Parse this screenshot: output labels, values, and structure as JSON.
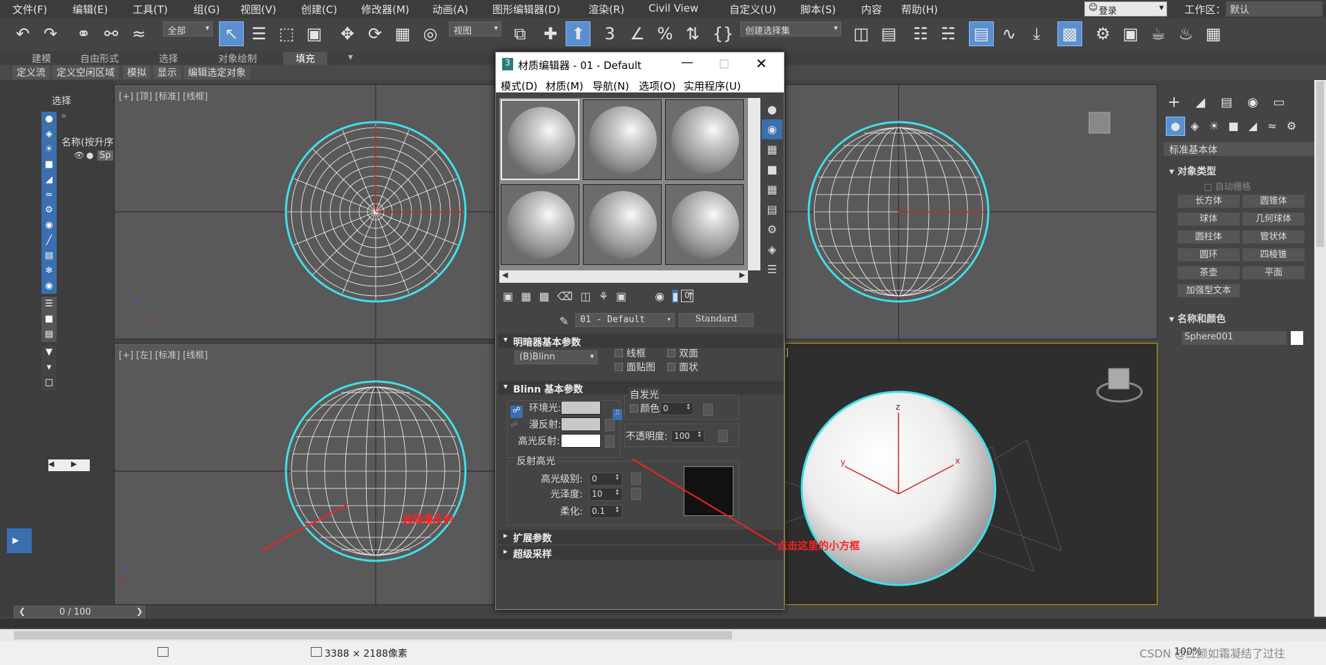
{
  "menu": [
    "文件(F)",
    "编辑(E)",
    "工具(T)",
    "组(G)",
    "视图(V)",
    "创建(C)",
    "修改器(M)",
    "动画(A)",
    "图形编辑器(D)",
    "渲染(R)",
    "Civil View",
    "自定义(U)",
    "脚本(S)",
    "内容",
    "帮助(H)"
  ],
  "login": "登录",
  "workspace_label": "工作区：",
  "workspace_value": "默认",
  "toolbar": {
    "filter": "全部",
    "viewcoord": "视图",
    "selset": "创建选择集"
  },
  "ribbon_tabs": [
    "建模",
    "自由形式",
    "选择",
    "对象绘制",
    "填充"
  ],
  "ribbon_buttons": [
    "定义流",
    "定义空闲区域",
    "模拟",
    "显示",
    "编辑选定对象"
  ],
  "scene": {
    "select": "选择",
    "name_col": "名称(按升序)",
    "row": "Sp"
  },
  "viewports": {
    "top": "[+] [顶] [标准] [线框]",
    "left": "[+] [左] [标准] [线框]",
    "persp_suffix": "]"
  },
  "timeline": {
    "frame": "0 / 100"
  },
  "cmd": {
    "category": "标准基本体",
    "rollout_type": "对象类型",
    "autogrid": "自动栅格",
    "buttons": [
      "长方体",
      "圆锥体",
      "球体",
      "几何球体",
      "圆柱体",
      "管状体",
      "圆环",
      "四棱锥",
      "茶壶",
      "平面",
      "加强型文本"
    ],
    "rollout_name": "名称和颜色",
    "objname": "Sphere001"
  },
  "matwin": {
    "title": "材质编辑器 - 01 - Default",
    "menus": [
      "模式(D)",
      "材质(M)",
      "导航(N)",
      "选项(O)",
      "实用程序(U)"
    ],
    "matname": "01 - Default",
    "mattype": "Standard",
    "zero": "0"
  },
  "shader": {
    "rollout": "明暗器基本参数",
    "type": "(B)Blinn",
    "wire": "线框",
    "twosided": "双面",
    "facemap": "面贴图",
    "faceted": "面状"
  },
  "blinn": {
    "rollout": "Blinn 基本参数",
    "selfillum": "自发光",
    "color": "颜色",
    "color_val": "0",
    "ambient": "环境光:",
    "diffuse": "漫反射:",
    "specular": "高光反射:",
    "opacity": "不透明度:",
    "opacity_val": "100",
    "spec_hl": "反射高光",
    "spec_level": "高光级别:",
    "spec_level_val": "0",
    "gloss": "光泽度:",
    "gloss_val": "10",
    "soften": "柔化:",
    "soften_val": "0.1"
  },
  "rollouts_closed": [
    "扩展参数",
    "超级采样"
  ],
  "annotations": {
    "diffuse_note": "选择漫反射",
    "box_note": "点击这里的小方框"
  },
  "status": {
    "dims": "3388 × 2188像素",
    "zoom": "100%",
    "watermark": "CSDN @红颜如霜凝结了过往"
  },
  "colors": {
    "accent": "#5a8fd0",
    "selection": "#40e0e8",
    "annotation": "#ff2020"
  }
}
